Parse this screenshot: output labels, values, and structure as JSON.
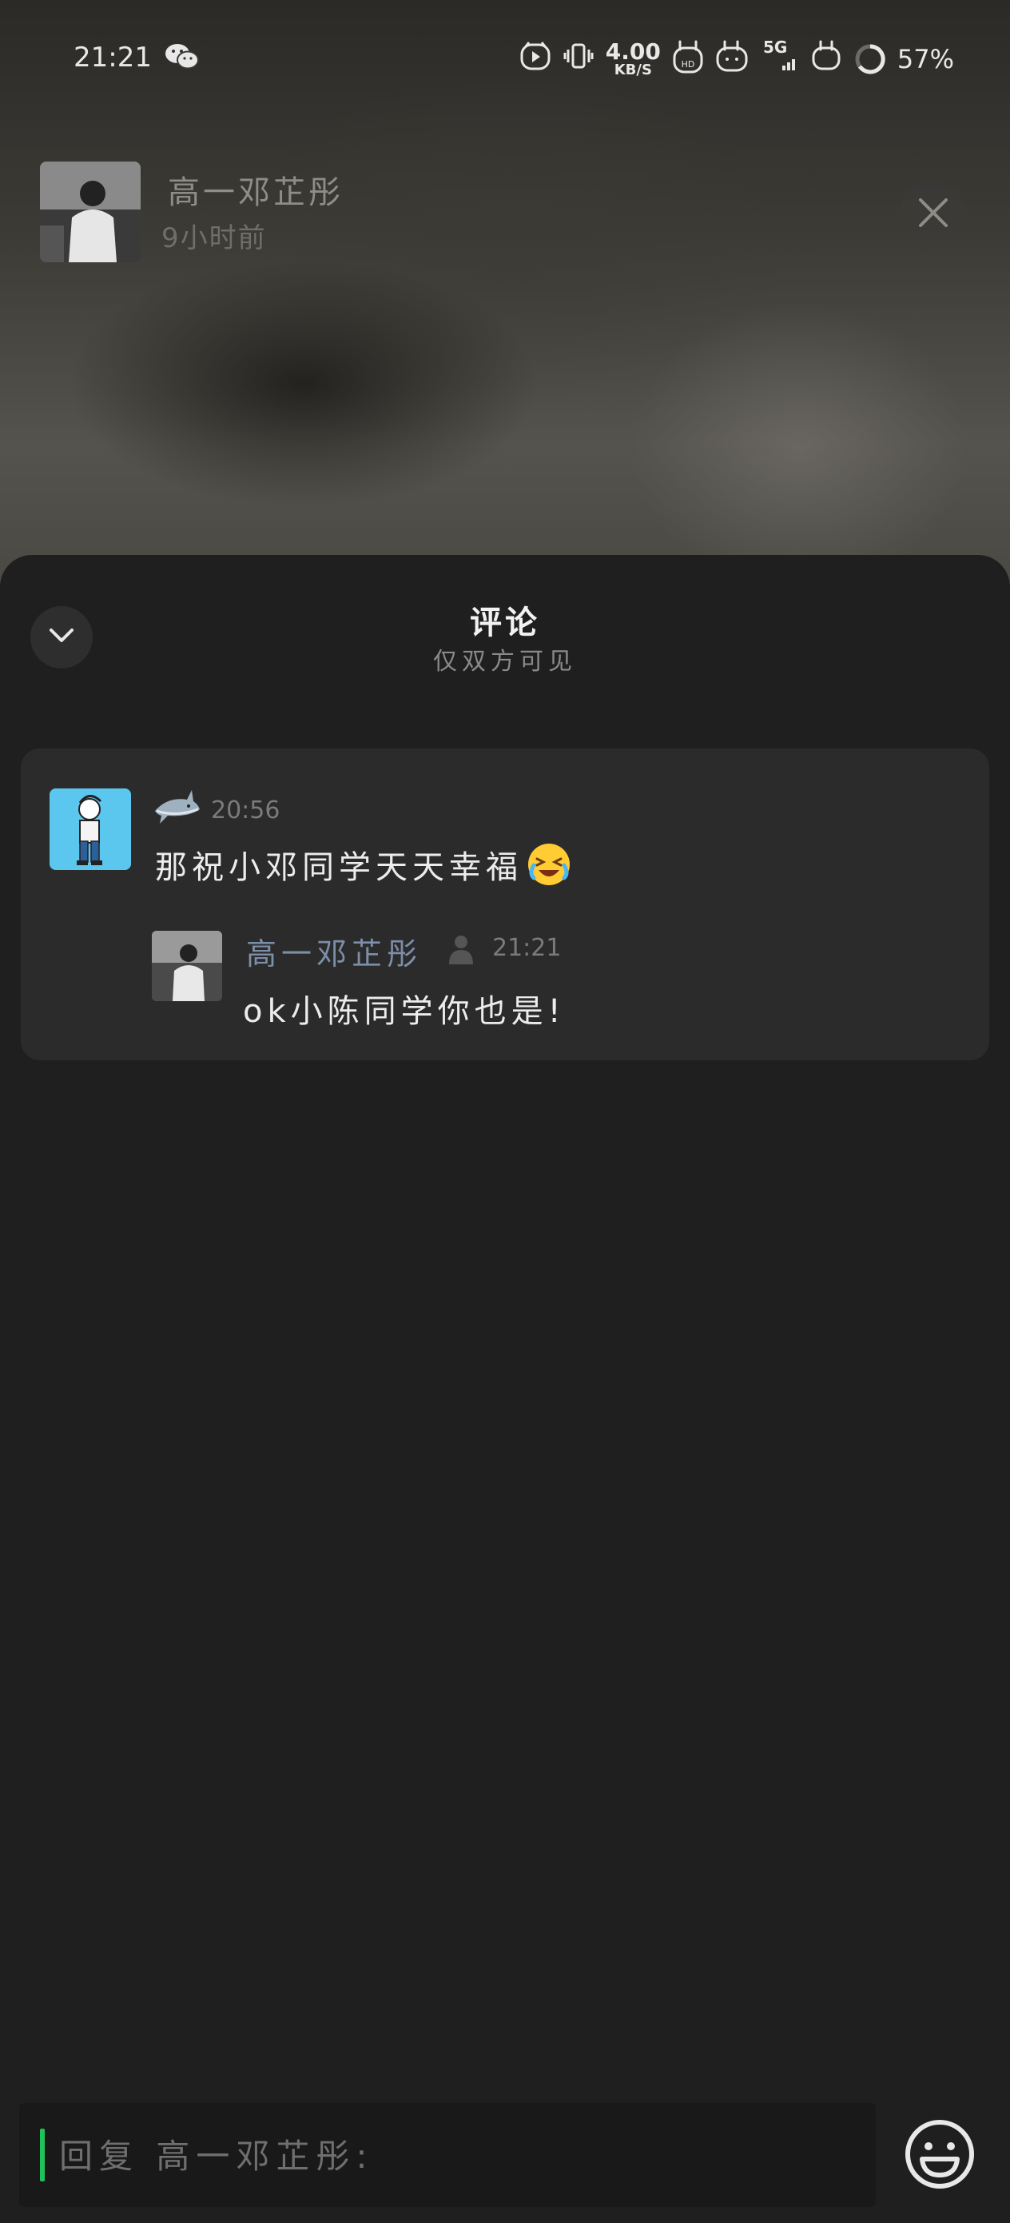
{
  "status_bar": {
    "time": "21:21",
    "net_speed_value": "4.00",
    "net_speed_unit": "KB/S",
    "network": "5G",
    "battery": "57%",
    "icons": [
      "wechat-icon",
      "music-app-icon",
      "vibrate-icon",
      "hd-icon",
      "bunny-icon",
      "wifi-icon",
      "signal-icon",
      "bunny-icon",
      "battery-ring-icon"
    ]
  },
  "post_author": {
    "name": "高一邓芷彤",
    "time_ago": "9小时前"
  },
  "comments_sheet": {
    "title": "评论",
    "subtitle": "仅双方可见",
    "comments": [
      {
        "nickname_icon": "shark-icon",
        "time": "20:56",
        "text": "那祝小邓同学天天幸福",
        "emoji": "laughing-tears-emoji",
        "reply": {
          "name": "高一邓芷彤",
          "author_badge_icon": "person-icon",
          "time": "21:21",
          "text": "ok小陈同学你也是!"
        }
      }
    ]
  },
  "reply_input": {
    "placeholder": "回复 高一邓芷彤:",
    "emoji_button_icon": "smile-icon"
  },
  "colors": {
    "sheet_background": "#1f1f1f",
    "card_background": "#2b2b2b",
    "reply_name": "#7d8ea8",
    "caret": "#1fc25a"
  }
}
